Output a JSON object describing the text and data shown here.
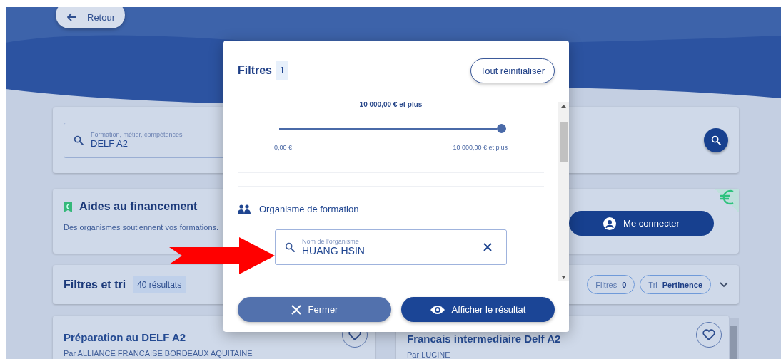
{
  "back_button": {
    "label": "Retour"
  },
  "search": {
    "label": "Formation, métier, compétences",
    "value": "DELF A2"
  },
  "funding": {
    "title": "Aides au financement",
    "text": "Des organismes soutiennent vos formations.",
    "login_button": "Me connecter"
  },
  "filters_bar": {
    "title": "Filtres et tri",
    "count": "40 résultats",
    "chips": [
      {
        "label": "Filtres",
        "value": "0"
      },
      {
        "label": "Tri",
        "value": "Pertinence"
      }
    ]
  },
  "results": [
    {
      "title": "Préparation au DELF A2",
      "provider": "Par ALLIANCE FRANCAISE BORDEAUX AQUITAINE"
    },
    {
      "title": "Francais intermediaire Delf A2",
      "provider": "Par LUCINE"
    }
  ],
  "modal": {
    "title": "Filtres",
    "count": "1",
    "reset_button": "Tout réinitialiser",
    "price": {
      "value_label": "10 000,00 € et plus",
      "level": 1,
      "min_label": "0,00 €",
      "max_label": "10 000,00 € et plus"
    },
    "section": {
      "title": "Organisme de formation",
      "field": {
        "label": "Nom de l'organisme",
        "value": "HUANG HSIN"
      }
    },
    "buttons": [
      {
        "label": "Fermer",
        "kind": "close"
      },
      {
        "label": "Afficher le résultat",
        "kind": "show"
      }
    ]
  }
}
